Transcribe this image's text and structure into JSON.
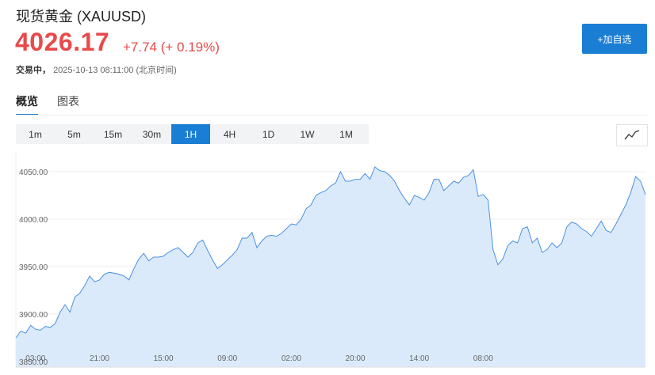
{
  "header": {
    "title": "现货黄金 (XAUUSD)",
    "price": "4026.17",
    "change": "+7.74 (+ 0.19%)",
    "status_label": "交易中，",
    "status_time": "2025-10-13 08:11:00 (北京时间)",
    "add_button": "+加自选"
  },
  "tabs": [
    {
      "label": "概览",
      "active": true
    },
    {
      "label": "图表",
      "active": false
    }
  ],
  "ranges": [
    {
      "label": "1m"
    },
    {
      "label": "5m"
    },
    {
      "label": "15m"
    },
    {
      "label": "30m"
    },
    {
      "label": "1H",
      "active": true
    },
    {
      "label": "4H"
    },
    {
      "label": "1D"
    },
    {
      "label": "1W"
    },
    {
      "label": "1M"
    }
  ],
  "chart_type_icon": "line-chart-icon",
  "colors": {
    "up": "#e84a4a",
    "accent": "#1a7ed4",
    "line": "#4a90e2",
    "fill": "#dbeafb"
  },
  "chart_data": {
    "type": "area",
    "ylim": [
      3850,
      4060
    ],
    "y_ticks": [
      3850,
      3900,
      3950,
      4000,
      4050
    ],
    "y_tick_labels": [
      "3850.00",
      "3900.00",
      "3950.00",
      "4000.00",
      "4050.00"
    ],
    "x_tick_labels": [
      "03:00",
      "21:00",
      "15:00",
      "09:00",
      "02:00",
      "20:00",
      "14:00",
      "08:00"
    ],
    "x_tick_index": [
      4,
      17,
      30,
      43,
      56,
      69,
      82,
      95
    ],
    "grid": true,
    "values": [
      3875,
      3882,
      3880,
      3888,
      3884,
      3883,
      3887,
      3886,
      3890,
      3902,
      3910,
      3902,
      3918,
      3922,
      3930,
      3940,
      3934,
      3936,
      3942,
      3944,
      3943,
      3942,
      3940,
      3936,
      3948,
      3958,
      3964,
      3956,
      3960,
      3960,
      3961,
      3965,
      3968,
      3970,
      3965,
      3960,
      3965,
      3975,
      3978,
      3967,
      3957,
      3948,
      3952,
      3957,
      3962,
      3968,
      3980,
      3980,
      3986,
      3970,
      3977,
      3982,
      3983,
      3982,
      3985,
      3990,
      3995,
      3994,
      4000,
      4011,
      4015,
      4025,
      4028,
      4030,
      4035,
      4038,
      4050,
      4040,
      4040,
      4042,
      4042,
      4048,
      4042,
      4055,
      4051,
      4050,
      4046,
      4040,
      4030,
      4022,
      4015,
      4025,
      4023,
      4020,
      4028,
      4042,
      4042,
      4030,
      4035,
      4040,
      4038,
      4044,
      4046,
      4052,
      4024,
      4026,
      4020,
      3968,
      3952,
      3958,
      3972,
      3977,
      3975,
      3990,
      3992,
      3975,
      3980,
      3965,
      3968,
      3975,
      3970,
      3975,
      3992,
      3997,
      3995,
      3990,
      3987,
      3982,
      3990,
      3998,
      3988,
      3986,
      3995,
      4005,
      4015,
      4028,
      4045,
      4040,
      4026
    ]
  }
}
